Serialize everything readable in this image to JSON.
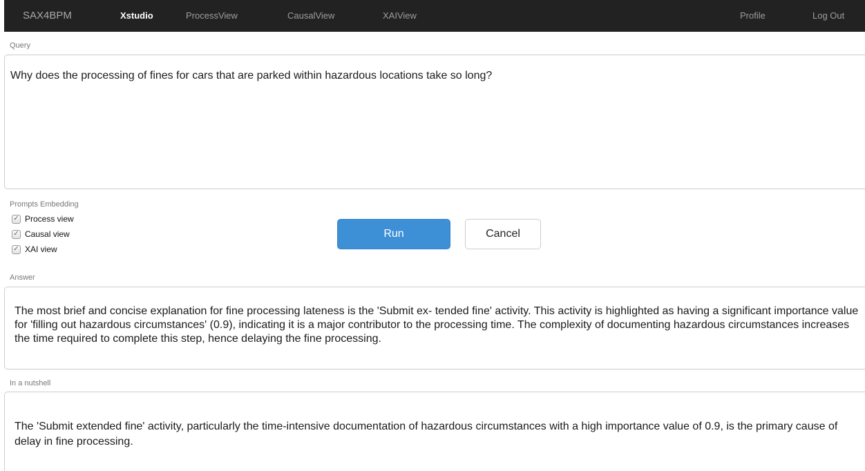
{
  "navbar": {
    "brand": "SAX4BPM",
    "items": [
      {
        "label": "Xstudio",
        "active": true
      },
      {
        "label": "ProcessView",
        "active": false
      },
      {
        "label": "CausalView",
        "active": false
      },
      {
        "label": "XAIView",
        "active": false
      }
    ],
    "right_items": [
      {
        "label": "Profile"
      },
      {
        "label": "Log Out"
      }
    ],
    "background_color": "#222222"
  },
  "query": {
    "label": "Query",
    "text": "Why does the processing of fines for cars that are parked within hazardous locations take so long?"
  },
  "prompts_embedding": {
    "label": "Prompts Embedding",
    "options": [
      {
        "label": "Process view",
        "checked": true
      },
      {
        "label": "Causal view",
        "checked": true
      },
      {
        "label": "XAI view",
        "checked": true
      }
    ],
    "check_glyph": "✓"
  },
  "actions": {
    "run_label": "Run",
    "cancel_label": "Cancel",
    "run_color": "#3d8fd6"
  },
  "answer": {
    "label": "Answer",
    "text": "The most brief and concise explanation for fine processing lateness is the 'Submit ex- tended fine' activity. This activity is highlighted as having a significant importance value for 'filling out hazardous circumstances' (0.9), indicating it is a major contributor to the processing time. The complexity of documenting hazardous circumstances increases the time required to complete this step, hence delaying the fine processing."
  },
  "nutshell": {
    "label": "In a nutshell",
    "text": "The 'Submit extended fine' activity, particularly the time-intensive documentation of hazardous circumstances with a high importance value of 0.9, is the primary cause of delay in fine processing."
  }
}
